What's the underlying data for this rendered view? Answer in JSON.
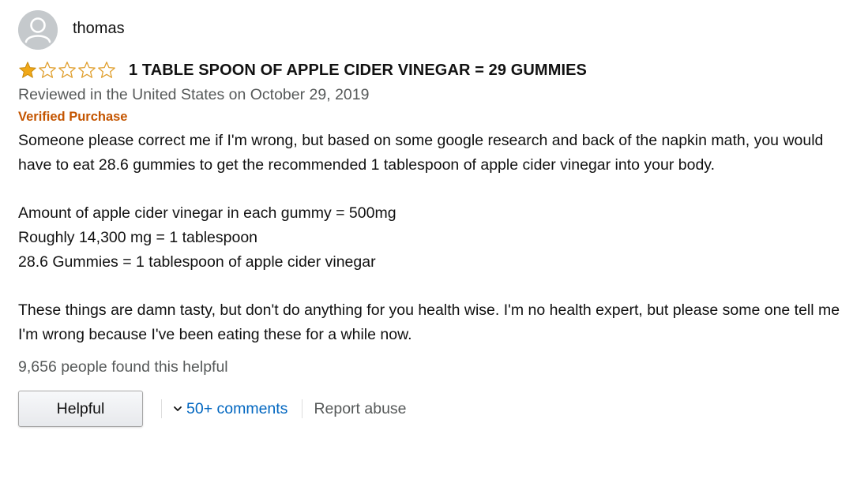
{
  "reviewer": {
    "name": "thomas",
    "avatar_icon": "default-avatar-icon"
  },
  "rating": {
    "value": 1,
    "max": 5,
    "filled_color": "#f0a818",
    "empty_color": "#e0a030"
  },
  "review": {
    "title": "1 TABLE SPOON OF APPLE CIDER VINEGAR = 29 GUMMIES",
    "date_line": "Reviewed in the United States on October 29, 2019",
    "verified": "Verified Purchase",
    "paragraph_1": "Someone please correct me if I'm wrong, but based on some google research and back of the napkin math, you would have to eat 28.6 gummies to get the recommended 1 tablespoon of apple cider vinegar into your body.",
    "line_1": "Amount of apple cider vinegar in each gummy = 500mg",
    "line_2": "Roughly 14,300 mg = 1 tablespoon",
    "line_3": "28.6 Gummies = 1 tablespoon of apple cider vinegar",
    "paragraph_3": "These things are damn tasty, but don't do anything for you health wise. I'm no health expert, but please some one tell me I'm wrong because I've been eating these for a while now.",
    "helpful_count": "9,656 people found this helpful"
  },
  "actions": {
    "helpful_label": "Helpful",
    "comments_label": "50+ comments",
    "comments_icon": "chevron-down-icon",
    "report_label": "Report abuse"
  },
  "colors": {
    "link": "#0066c0",
    "verified": "#c45500",
    "muted": "#565959"
  }
}
